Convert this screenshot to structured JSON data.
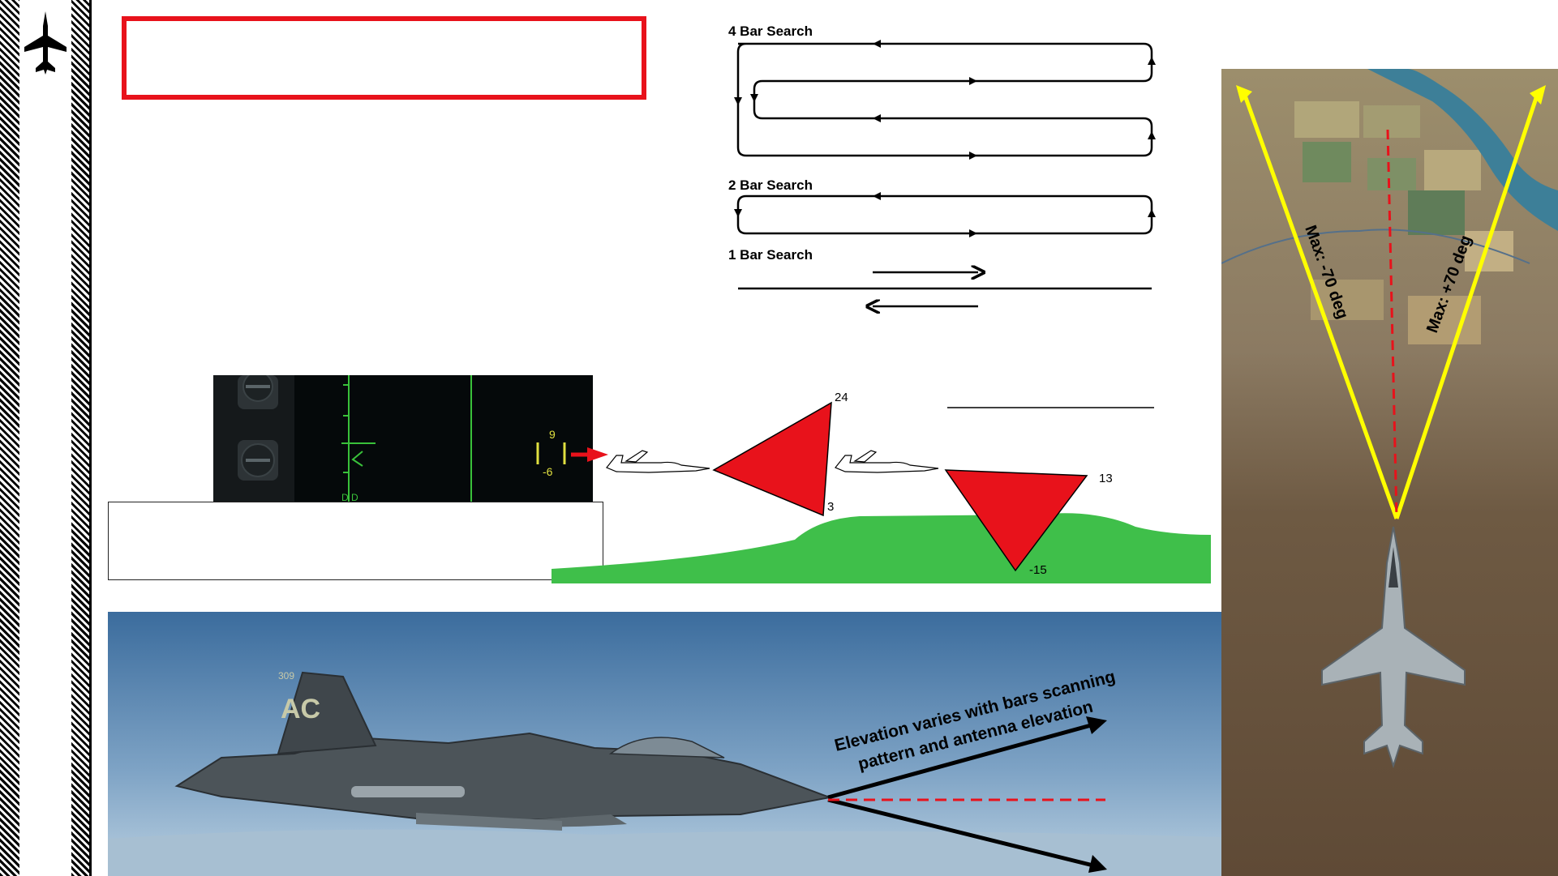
{
  "scan_patterns": {
    "bar4_label": "4 Bar Search",
    "bar2_label": "2 Bar Search",
    "bar1_label": "1 Bar Search"
  },
  "radar_display": {
    "upper_value": "9",
    "lower_value": "-6"
  },
  "elevation_diagram": {
    "up_high": "24",
    "up_low": "3",
    "down_high": "13",
    "down_low": "-15"
  },
  "azimuth": {
    "left_limit": "Max: -70 deg",
    "right_limit": "Max: +70 deg"
  },
  "side_view": {
    "annotation_line1": "Elevation varies with bars scanning",
    "annotation_line2": "pattern and antenna elevation",
    "tail_code": "AC",
    "tail_number": "309"
  },
  "colors": {
    "accent_red": "#e8121b",
    "ground_green": "#3fbf4a",
    "beam_yellow": "#ffff00",
    "hud_green": "#39c13a",
    "hud_yellow": "#e0e040"
  }
}
